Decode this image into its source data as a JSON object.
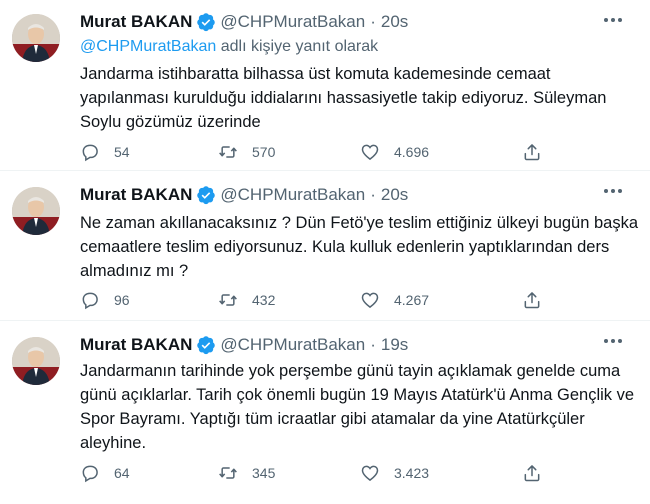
{
  "tweets": [
    {
      "author_name": "Murat BAKAN",
      "handle": "@CHPMuratBakan",
      "separator": "·",
      "time": "20s",
      "reply_to_handle": "@CHPMuratBakan",
      "reply_to_suffix": " adlı kişiye yanıt olarak",
      "text": "Jandarma istihbaratta bilhassa üst komuta kademesinde cemaat yapılanması kurulduğu iddialarını hassasiyetle takip ediyoruz. Süleyman Soylu gözümüz üzerinde",
      "replies": "54",
      "retweets": "570",
      "likes": "4.696"
    },
    {
      "author_name": "Murat BAKAN",
      "handle": "@CHPMuratBakan",
      "separator": "·",
      "time": "20s",
      "text": "Ne zaman akıllanacaksınız ? Dün Fetö'ye teslim ettiğiniz ülkeyi bugün başka cemaatlere teslim ediyorsunuz.  Kula kulluk edenlerin yaptıklarından ders almadınız mı ?",
      "replies": "96",
      "retweets": "432",
      "likes": "4.267"
    },
    {
      "author_name": "Murat BAKAN",
      "handle": "@CHPMuratBakan",
      "separator": "·",
      "time": "19s",
      "text": "Jandarmanın tarihinde yok perşembe günü tayin açıklamak genelde cuma günü açıklarlar. Tarih çok önemli bugün 19 Mayıs Atatürk'ü Anma Gençlik ve Spor Bayramı. Yaptığı tüm icraatlar gibi atamalar da yine Atatürkçüler aleyhine.",
      "replies": "64",
      "retweets": "345",
      "likes": "3.423"
    }
  ],
  "colors": {
    "text": "#0f1419",
    "secondary": "#536471",
    "link": "#1d9bf0",
    "verified": "#1d9bf0",
    "divider": "#eff3f4"
  },
  "icons": [
    "verified-badge-icon",
    "more-icon",
    "reply-icon",
    "retweet-icon",
    "like-icon",
    "share-icon"
  ]
}
